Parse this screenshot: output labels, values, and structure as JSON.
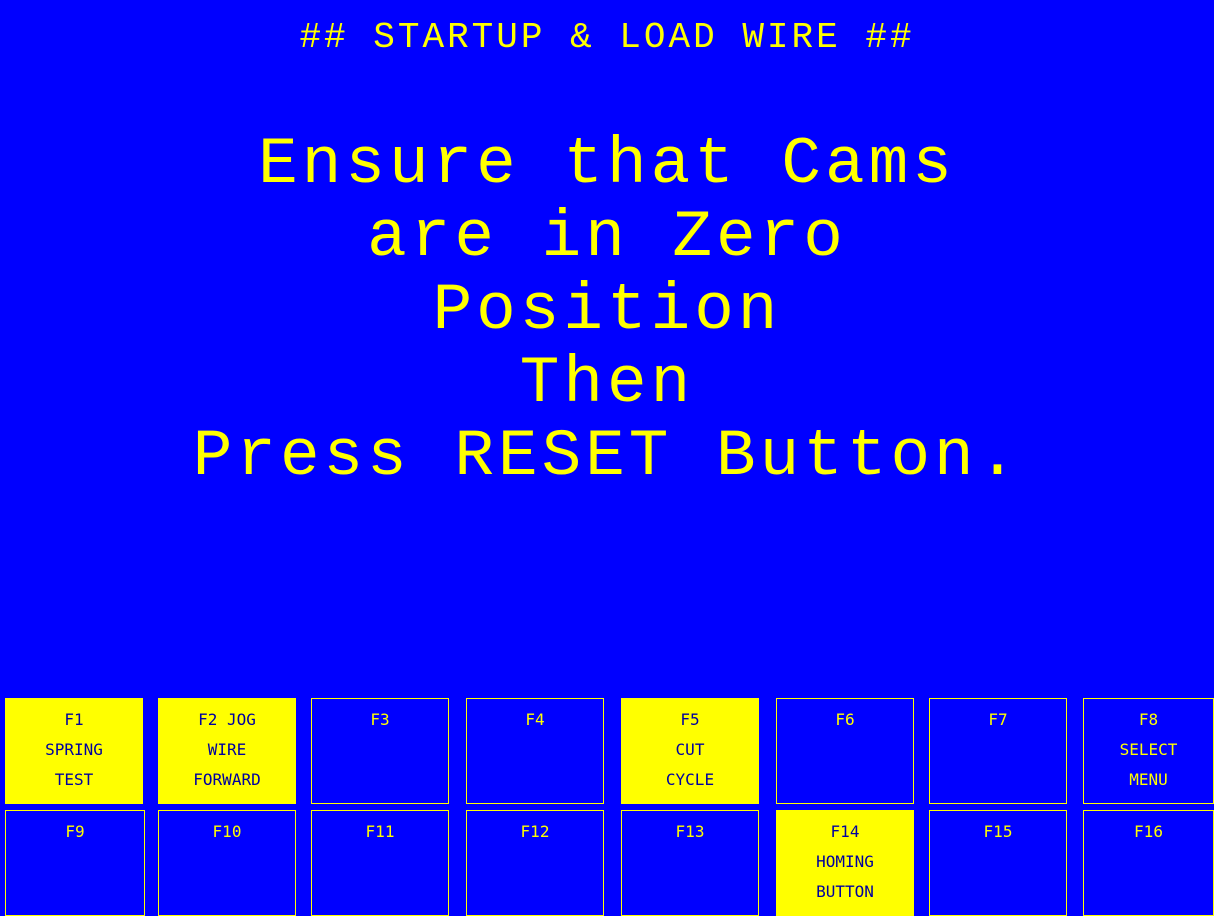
{
  "screen": {
    "title": "## STARTUP & LOAD WIRE ##",
    "message_lines": [
      "Ensure that Cams",
      "are in Zero",
      "Position",
      "Then",
      "Press RESET Button."
    ]
  },
  "function_keys": {
    "row1": [
      {
        "label": "F1\nSPRING\nTEST",
        "active": true
      },
      {
        "label": "F2 JOG\nWIRE\nFORWARD",
        "active": true
      },
      {
        "label": "F3",
        "active": false
      },
      {
        "label": "F4",
        "active": false
      },
      {
        "label": "F5\nCUT\nCYCLE",
        "active": true
      },
      {
        "label": "F6",
        "active": false
      },
      {
        "label": "F7",
        "active": false
      },
      {
        "label": "F8\nSELECT\nMENU",
        "active": false
      }
    ],
    "row2": [
      {
        "label": "F9",
        "active": false
      },
      {
        "label": "F10",
        "active": false
      },
      {
        "label": "F11",
        "active": false
      },
      {
        "label": "F12",
        "active": false
      },
      {
        "label": "F13",
        "active": false
      },
      {
        "label": "F14\nHOMING\nBUTTON",
        "active": true
      },
      {
        "label": "F15",
        "active": false
      },
      {
        "label": "F16",
        "active": false
      }
    ]
  },
  "colors": {
    "background": "#0000ff",
    "foreground": "#ffff00",
    "active_text": "#0000a0"
  }
}
